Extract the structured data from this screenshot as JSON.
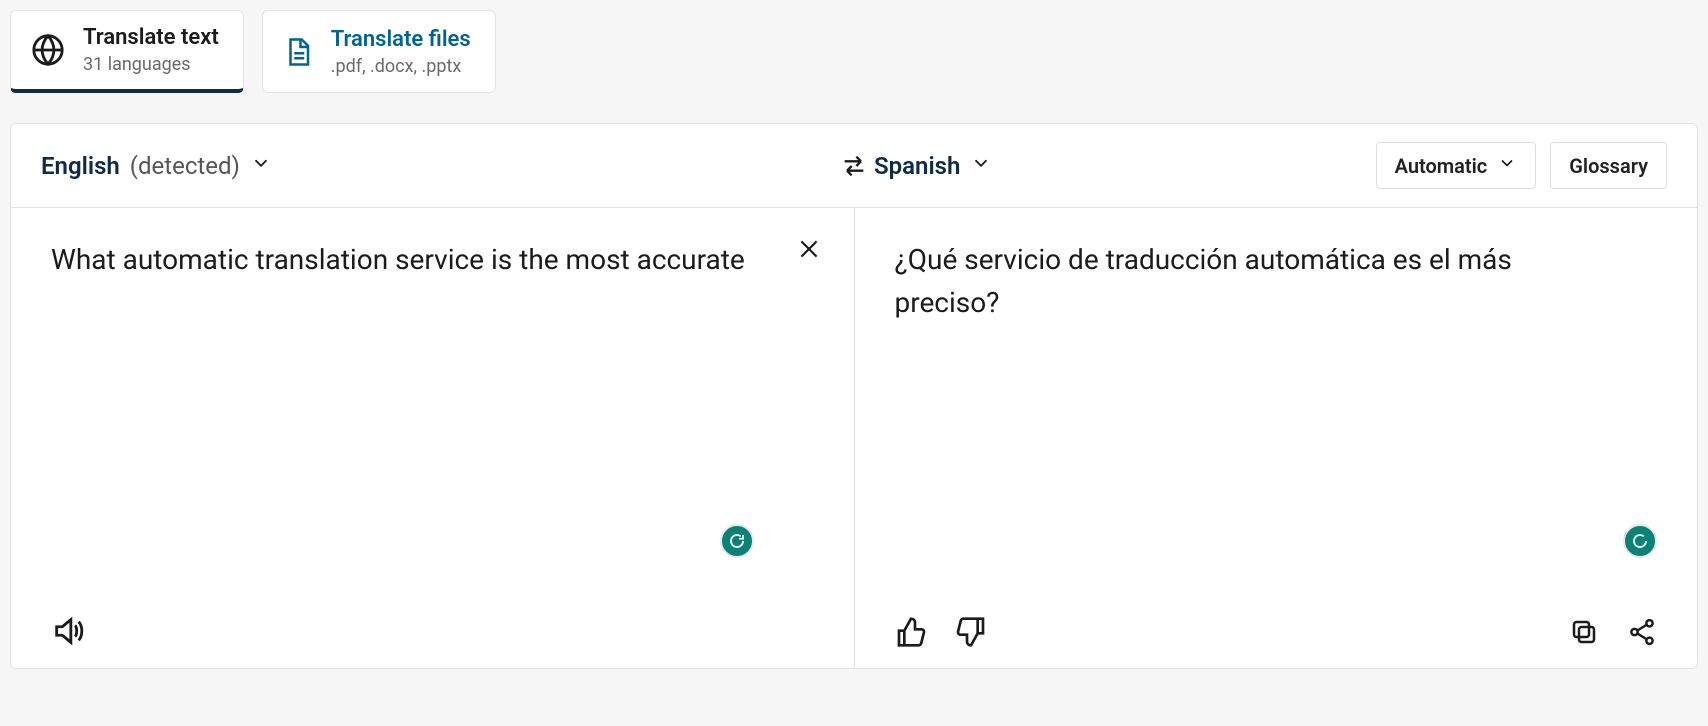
{
  "tabs": {
    "text": {
      "title": "Translate text",
      "sub": "31 languages"
    },
    "files": {
      "title": "Translate files",
      "sub": ".pdf, .docx, .pptx"
    }
  },
  "source": {
    "lang": "English",
    "detected": "(detected)",
    "text": "What automatic translation service is the most accurate"
  },
  "target": {
    "lang": "Spanish",
    "text": "¿Qué servicio de traducción automática es el más preciso?"
  },
  "controls": {
    "tone": "Automatic",
    "glossary": "Glossary"
  }
}
